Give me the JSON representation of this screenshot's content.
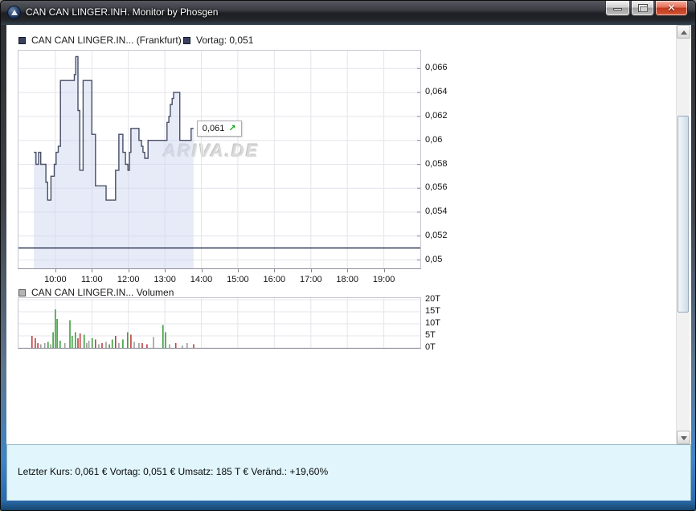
{
  "window": {
    "title": "CAN CAN LINGER.INH. Monitor by Phosgen",
    "icon": "ariva-logo",
    "buttons": {
      "minimize": "minimize",
      "maximize": "maximize",
      "close": "close"
    },
    "close_glyph": "✕"
  },
  "legends": {
    "price": [
      {
        "marker": "navy-square",
        "label": "CAN CAN LINGER.IN... (Frankfurt)"
      },
      {
        "marker": "navy-square",
        "label": "Vortag: 0,051"
      }
    ],
    "volume": [
      {
        "marker": "gray-square",
        "label": "CAN CAN LINGER.IN... Volumen"
      }
    ]
  },
  "watermark": {
    "text": "ARIVA.DE"
  },
  "status_bar": {
    "text": "Letzter Kurs: 0,061 € Vortag: 0,051 € Umsatz: 185 T € Veränd.: +19,60%"
  },
  "colors": {
    "price_line": "#474e66",
    "area_fill": "rgba(206,216,240,0.5)",
    "reference_line": "#2b3552",
    "grid": "#e4e4eb",
    "volume_up": "#3f9e3f",
    "volume_down": "#bf4040",
    "volume_neutral": "#9c9c9c",
    "arrow_up": "#14a314",
    "status_bg": "#e0f5fc"
  },
  "chart_data": [
    {
      "type": "step-area",
      "name": "CAN CAN LINGER.IN... (Frankfurt)",
      "x_axis": {
        "min": 8.99,
        "max": 20.0
      },
      "y_axis": {
        "min": 0.0493,
        "max": 0.0675
      },
      "x_ticks": [
        {
          "t": 10,
          "label": "10:00"
        },
        {
          "t": 11,
          "label": "11:00"
        },
        {
          "t": 12,
          "label": "12:00"
        },
        {
          "t": 13,
          "label": "13:00"
        },
        {
          "t": 14,
          "label": "14:00"
        },
        {
          "t": 15,
          "label": "15:00"
        },
        {
          "t": 16,
          "label": "16:00"
        },
        {
          "t": 17,
          "label": "17:00"
        },
        {
          "t": 18,
          "label": "18:00"
        },
        {
          "t": 19,
          "label": "19:00"
        }
      ],
      "y_ticks": [
        {
          "v": 0.066,
          "label": "0,066"
        },
        {
          "v": 0.064,
          "label": "0,064"
        },
        {
          "v": 0.062,
          "label": "0,062"
        },
        {
          "v": 0.06,
          "label": "0,06"
        },
        {
          "v": 0.058,
          "label": "0,058"
        },
        {
          "v": 0.056,
          "label": "0,056"
        },
        {
          "v": 0.054,
          "label": "0,054"
        },
        {
          "v": 0.052,
          "label": "0,052"
        },
        {
          "v": 0.05,
          "label": "0,05"
        }
      ],
      "reference_line": {
        "value": 0.051,
        "label": "Vortag: 0,051"
      },
      "last_point": {
        "t": 13.72,
        "value": 0.061,
        "label": "0,061",
        "arrow_glyph": "↗",
        "arrow_icon": "arrow-up-right"
      },
      "series": [
        [
          9.41,
          0.059
        ],
        [
          9.47,
          0.058
        ],
        [
          9.54,
          0.059
        ],
        [
          9.6,
          0.058
        ],
        [
          9.74,
          0.0565
        ],
        [
          9.79,
          0.055
        ],
        [
          9.88,
          0.057
        ],
        [
          9.97,
          0.058
        ],
        [
          10.02,
          0.059
        ],
        [
          10.08,
          0.0595
        ],
        [
          10.14,
          0.065
        ],
        [
          10.52,
          0.0655
        ],
        [
          10.56,
          0.067
        ],
        [
          10.62,
          0.0625
        ],
        [
          10.67,
          0.0575
        ],
        [
          10.76,
          0.065
        ],
        [
          11.0,
          0.0605
        ],
        [
          11.1,
          0.0562
        ],
        [
          11.39,
          0.055
        ],
        [
          11.65,
          0.0575
        ],
        [
          11.74,
          0.0605
        ],
        [
          11.85,
          0.059
        ],
        [
          11.92,
          0.058
        ],
        [
          11.99,
          0.0575
        ],
        [
          12.03,
          0.059
        ],
        [
          12.07,
          0.061
        ],
        [
          12.29,
          0.06
        ],
        [
          12.36,
          0.0595
        ],
        [
          12.4,
          0.059
        ],
        [
          12.45,
          0.0585
        ],
        [
          12.54,
          0.06
        ],
        [
          13.06,
          0.0615
        ],
        [
          13.11,
          0.062
        ],
        [
          13.15,
          0.063
        ],
        [
          13.2,
          0.0635
        ],
        [
          13.24,
          0.064
        ],
        [
          13.41,
          0.06
        ],
        [
          13.72,
          0.061
        ]
      ]
    },
    {
      "type": "bar",
      "name": "CAN CAN LINGER.IN... Volumen",
      "x_axis": {
        "min": 8.99,
        "max": 20.0
      },
      "y_axis": {
        "min": 0,
        "max": 20.67
      },
      "y_ticks": [
        {
          "v": 20,
          "label": "20T"
        },
        {
          "v": 15,
          "label": "15T"
        },
        {
          "v": 10,
          "label": "10T"
        },
        {
          "v": 5,
          "label": "5T"
        },
        {
          "v": 0,
          "label": "0T"
        }
      ],
      "bars": [
        [
          9.36,
          5,
          "d"
        ],
        [
          9.45,
          4,
          "d"
        ],
        [
          9.52,
          2,
          "d"
        ],
        [
          9.6,
          1.5,
          "n"
        ],
        [
          9.71,
          2,
          "n"
        ],
        [
          9.8,
          2.5,
          "u"
        ],
        [
          9.87,
          1.5,
          "n"
        ],
        [
          9.94,
          6.5,
          "u"
        ],
        [
          10.0,
          16,
          "u"
        ],
        [
          10.05,
          12,
          "u"
        ],
        [
          10.13,
          3,
          "u"
        ],
        [
          10.26,
          2,
          "n"
        ],
        [
          10.4,
          11.5,
          "u"
        ],
        [
          10.46,
          5,
          "u"
        ],
        [
          10.55,
          6.5,
          "u"
        ],
        [
          10.62,
          4,
          "d"
        ],
        [
          10.68,
          6,
          "d"
        ],
        [
          10.79,
          5.5,
          "u"
        ],
        [
          10.86,
          2,
          "n"
        ],
        [
          10.92,
          3,
          "n"
        ],
        [
          11.01,
          4,
          "u"
        ],
        [
          11.1,
          3.5,
          "d"
        ],
        [
          11.19,
          1.5,
          "n"
        ],
        [
          11.28,
          2,
          "d"
        ],
        [
          11.39,
          2.5,
          "n"
        ],
        [
          11.48,
          1.5,
          "u"
        ],
        [
          11.56,
          3.5,
          "u"
        ],
        [
          11.65,
          5,
          "d"
        ],
        [
          11.74,
          2,
          "n"
        ],
        [
          11.85,
          3.5,
          "u"
        ],
        [
          11.98,
          6.5,
          "u"
        ],
        [
          12.07,
          5.5,
          "d"
        ],
        [
          12.16,
          2.5,
          "n"
        ],
        [
          12.29,
          2,
          "n"
        ],
        [
          12.38,
          2,
          "d"
        ],
        [
          12.51,
          1.5,
          "d"
        ],
        [
          12.69,
          4.5,
          "n"
        ],
        [
          12.95,
          9.5,
          "u"
        ],
        [
          13.02,
          6.5,
          "u"
        ],
        [
          13.13,
          1.5,
          "n"
        ],
        [
          13.3,
          2,
          "d"
        ],
        [
          13.48,
          1,
          "n"
        ],
        [
          13.61,
          2,
          "n"
        ],
        [
          13.79,
          1.5,
          "d"
        ]
      ]
    }
  ]
}
